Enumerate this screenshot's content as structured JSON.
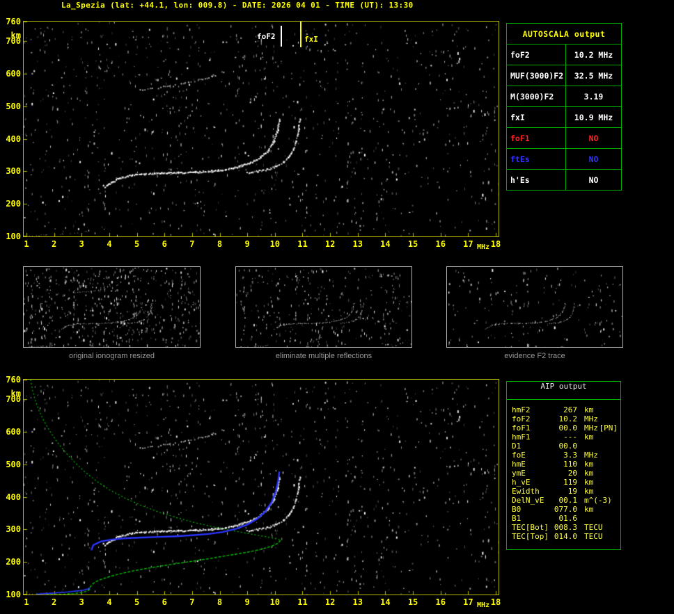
{
  "title": "La_Spezia (lat: +44.1, lon: 009.8) - DATE: 2026 04 01 - TIME (UT): 13:30",
  "colors": {
    "white": "#ffffff",
    "red": "#ff2020",
    "blue": "#3333ff",
    "yellow": "#ffff00",
    "green": "#00ae00",
    "gray": "#9a9a9a",
    "trace_blue": "#2b35ff",
    "profile_green": "#00bf00"
  },
  "axes": {
    "x_ticks": [
      "1",
      "2",
      "3",
      "4",
      "5",
      "6",
      "7",
      "8",
      "9",
      "10",
      "11",
      "12",
      "13",
      "14",
      "15",
      "16",
      "17",
      "18"
    ],
    "y_ticks": [
      "760",
      "700",
      "600",
      "500",
      "400",
      "300",
      "200",
      "100"
    ],
    "x_unit": "MHz",
    "y_unit": "km"
  },
  "autoscala_table": {
    "header": "AUTOSCALA output",
    "rows": [
      {
        "label": "foF2",
        "value": "10.2 MHz",
        "color": "white"
      },
      {
        "label": "MUF(3000)F2",
        "value": "32.5 MHz",
        "color": "white"
      },
      {
        "label": "M(3000)F2",
        "value": "3.19",
        "color": "white"
      },
      {
        "label": "fxI",
        "value": "10.9 MHz",
        "color": "white"
      },
      {
        "label": "foF1",
        "value": "NO",
        "color": "red"
      },
      {
        "label": "ftEs",
        "value": "NO",
        "color": "blue"
      },
      {
        "label": "h'Es",
        "value": "NO",
        "color": "white"
      }
    ]
  },
  "thumbnails": [
    {
      "caption": "original ionogram resized"
    },
    {
      "caption": "eliminate multiple reflections"
    },
    {
      "caption": "evidence F2 trace"
    }
  ],
  "aip_table": {
    "header": "AIP output",
    "rows": [
      {
        "label": "hmF2",
        "value": "267",
        "unit": "km"
      },
      {
        "label": "foF2",
        "value": "10.2",
        "unit": "MHz"
      },
      {
        "label": "foF1",
        "value": "00.0",
        "unit": "MHz",
        "extra": "[PN]"
      },
      {
        "label": "hmF1",
        "value": "---",
        "unit": "km"
      },
      {
        "label": "D1",
        "value": "00.0",
        "unit": ""
      },
      {
        "label": "foE",
        "value": "3.3",
        "unit": "MHz"
      },
      {
        "label": "hmE",
        "value": "110",
        "unit": "km"
      },
      {
        "label": "ymE",
        "value": "20",
        "unit": "km"
      },
      {
        "label": "h_vE",
        "value": "119",
        "unit": "km"
      },
      {
        "label": "Ewidth",
        "value": "19",
        "unit": "km"
      },
      {
        "label": "DelN_vE",
        "value": "00.1",
        "unit": "m^(-3)"
      },
      {
        "label": "B0",
        "value": "077.0",
        "unit": "km"
      },
      {
        "label": "B1",
        "value": "01.6",
        "unit": ""
      },
      {
        "label": "TEC[Bot]",
        "value": "008.3",
        "unit": "TECU"
      },
      {
        "label": "TEC[Top]",
        "value": "014.0",
        "unit": "TECU"
      }
    ]
  },
  "chart_data": [
    {
      "type": "scatter",
      "title": "ionogram (virtual height vs frequency)",
      "xlabel": "MHz",
      "ylabel": "km",
      "xlim": [
        1,
        18
      ],
      "ylim": [
        100,
        760
      ],
      "grid": false,
      "markers": [
        {
          "label": "foF2",
          "x": 10.2
        },
        {
          "label": "fxI",
          "x": 10.9
        }
      ],
      "series": [
        {
          "name": "F2-ordinary-trace",
          "points": [
            [
              3.8,
              250
            ],
            [
              4.05,
              266
            ],
            [
              4.35,
              281
            ],
            [
              4.8,
              290
            ],
            [
              5.3,
              294
            ],
            [
              5.9,
              296
            ],
            [
              6.5,
              297
            ],
            [
              7.1,
              299
            ],
            [
              7.7,
              302
            ],
            [
              8.2,
              307
            ],
            [
              8.7,
              316
            ],
            [
              9.1,
              328
            ],
            [
              9.45,
              344
            ],
            [
              9.75,
              366
            ],
            [
              9.95,
              394
            ],
            [
              10.08,
              428
            ],
            [
              10.15,
              462
            ]
          ]
        },
        {
          "name": "F2-extraordinary-trace",
          "points": [
            [
              8.95,
              297
            ],
            [
              9.35,
              301
            ],
            [
              9.75,
              308
            ],
            [
              10.05,
              317
            ],
            [
              10.3,
              330
            ],
            [
              10.5,
              347
            ],
            [
              10.66,
              370
            ],
            [
              10.77,
              400
            ],
            [
              10.84,
              433
            ],
            [
              10.89,
              463
            ]
          ]
        },
        {
          "name": "multiple-reflection-trace",
          "points": [
            [
              5.05,
              553
            ],
            [
              5.45,
              556
            ],
            [
              5.9,
              560
            ],
            [
              6.35,
              566
            ],
            [
              6.8,
              574
            ],
            [
              7.25,
              583
            ],
            [
              7.7,
              594
            ],
            [
              8.05,
              605
            ],
            [
              8.3,
              618
            ]
          ]
        },
        {
          "name": "E-region-trace",
          "points": [
            [
              1.1,
              102
            ],
            [
              1.7,
              105
            ],
            [
              2.3,
              108
            ],
            [
              2.85,
              112
            ],
            [
              3.25,
              118
            ]
          ]
        }
      ]
    },
    {
      "type": "scatter",
      "title": "ionogram with restored trace and electron density profile",
      "xlabel": "MHz",
      "ylabel": "km",
      "xlim": [
        1,
        18
      ],
      "ylim": [
        100,
        760
      ],
      "series": [
        {
          "name": "restored-F2-trace",
          "color": "trace_blue",
          "points": [
            [
              3.35,
              236
            ],
            [
              3.42,
              252
            ],
            [
              3.7,
              263
            ],
            [
              4.1,
              269
            ],
            [
              4.6,
              273
            ],
            [
              5.2,
              275
            ],
            [
              5.8,
              277
            ],
            [
              6.4,
              279
            ],
            [
              7.0,
              282
            ],
            [
              7.6,
              286
            ],
            [
              8.1,
              292
            ],
            [
              8.6,
              302
            ],
            [
              9.0,
              315
            ],
            [
              9.35,
              332
            ],
            [
              9.65,
              355
            ],
            [
              9.88,
              383
            ],
            [
              10.03,
              416
            ],
            [
              10.12,
              450
            ],
            [
              10.16,
              478
            ]
          ]
        },
        {
          "name": "restored-E-trace",
          "color": "trace_blue",
          "points": [
            [
              1.35,
              101
            ],
            [
              1.9,
              104
            ],
            [
              2.5,
              108
            ],
            [
              3.05,
              113
            ],
            [
              3.3,
              119
            ]
          ]
        },
        {
          "name": "profile-topside",
          "color": "profile_green",
          "points": [
            [
              1.15,
              760
            ],
            [
              1.22,
              728
            ],
            [
              1.32,
              696
            ],
            [
              1.46,
              664
            ],
            [
              1.64,
              632
            ],
            [
              1.86,
              600
            ],
            [
              2.12,
              568
            ],
            [
              2.42,
              536
            ],
            [
              2.76,
              505
            ],
            [
              3.14,
              475
            ],
            [
              3.56,
              447
            ],
            [
              4.02,
              421
            ],
            [
              4.55,
              397
            ],
            [
              5.12,
              375
            ],
            [
              5.74,
              355
            ],
            [
              6.4,
              337
            ],
            [
              7.1,
              321
            ],
            [
              7.82,
              307
            ],
            [
              8.55,
              295
            ],
            [
              9.25,
              284
            ],
            [
              9.8,
              276
            ],
            [
              10.1,
              270
            ],
            [
              10.2,
              267
            ]
          ]
        },
        {
          "name": "profile-bottomside",
          "color": "profile_green",
          "points": [
            [
              10.2,
              267
            ],
            [
              10.12,
              258
            ],
            [
              9.9,
              249
            ],
            [
              9.5,
              239
            ],
            [
              8.95,
              229
            ],
            [
              8.3,
              220
            ],
            [
              7.6,
              210
            ],
            [
              6.9,
              201
            ],
            [
              6.2,
              192
            ],
            [
              5.55,
              183
            ],
            [
              4.95,
              174
            ],
            [
              4.45,
              165
            ],
            [
              4.05,
              156
            ],
            [
              3.75,
              148
            ],
            [
              3.55,
              141
            ],
            [
              3.42,
              134
            ],
            [
              3.35,
              128
            ],
            [
              3.31,
              123
            ],
            [
              3.3,
              119
            ],
            [
              3.27,
              114
            ],
            [
              3.18,
              110
            ],
            [
              3.0,
              106
            ],
            [
              2.72,
              103
            ],
            [
              2.38,
              101
            ],
            [
              2.0,
              100
            ],
            [
              1.7,
              100
            ]
          ]
        }
      ]
    }
  ]
}
